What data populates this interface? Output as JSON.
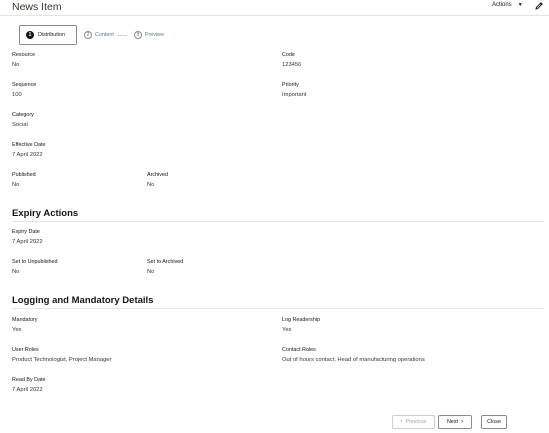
{
  "header": {
    "title": "News Item",
    "actions_label": "Actions",
    "actions_icon": "caret-down-icon",
    "edit_icon": "pencil-icon"
  },
  "train": {
    "steps": [
      {
        "number": "1",
        "label": "Distribution",
        "active": true
      },
      {
        "number": "2",
        "label": "Content",
        "active": false
      },
      {
        "number": "3",
        "label": "Preview",
        "active": false
      }
    ]
  },
  "distribution": {
    "resource": {
      "label": "Resource",
      "value": "No"
    },
    "code": {
      "label": "Code",
      "value": "123456"
    },
    "sequence": {
      "label": "Sequence",
      "value": "100"
    },
    "priority": {
      "label": "Priority",
      "value": "Important"
    },
    "category": {
      "label": "Category",
      "value": "Social"
    },
    "effective_date": {
      "label": "Effective Date",
      "value": "7 April 2022"
    },
    "published": {
      "label": "Published",
      "value": "No"
    },
    "archived": {
      "label": "Archived",
      "value": "No"
    }
  },
  "expiry": {
    "title": "Expiry Actions",
    "expiry_date": {
      "label": "Expiry Date",
      "value": "7 April 2022"
    },
    "set_unpublished": {
      "label": "Set to Unpublished",
      "value": "No"
    },
    "set_archived": {
      "label": "Set to Archived",
      "value": "No"
    }
  },
  "logging": {
    "title": "Logging and Mandatory Details",
    "mandatory": {
      "label": "Mandatory",
      "value": "Yes"
    },
    "log_readership": {
      "label": "Log Readership",
      "value": "Yes"
    },
    "user_roles": {
      "label": "User Roles",
      "value": "Product Technologist, Project Manager"
    },
    "contact_roles": {
      "label": "Contact Roles",
      "value": "Out of hours contact, Head of manufacturing operations"
    },
    "read_by_date": {
      "label": "Read By Date",
      "value": "7 April 2022"
    }
  },
  "footer": {
    "previous_label": "Previous",
    "next_label": "Next",
    "close_label": "Close"
  }
}
